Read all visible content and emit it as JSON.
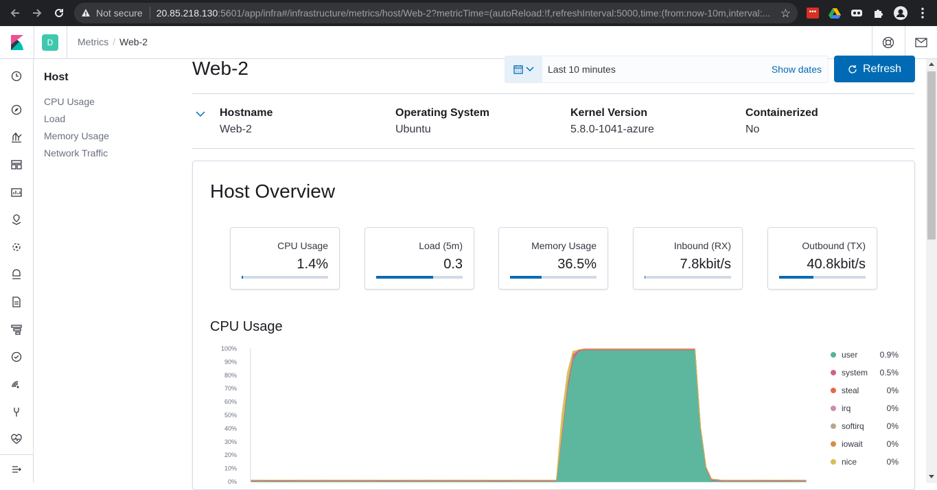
{
  "browser": {
    "security_label": "Not secure",
    "url_host": "20.85.218.130",
    "url_rest": ":5601/app/infra#/infrastructure/metrics/host/Web-2?metricTime=(autoReload:!f,refreshInterval:5000,time:(from:now-10m,interval:..."
  },
  "header": {
    "space_initial": "D",
    "breadcrumbs": [
      "Metrics",
      "Web-2"
    ]
  },
  "sidebar": {
    "title": "Host",
    "items": [
      "CPU Usage",
      "Load",
      "Memory Usage",
      "Network Traffic"
    ]
  },
  "page": {
    "title": "Web-2",
    "time_range": "Last 10 minutes",
    "show_dates": "Show dates",
    "refresh": "Refresh"
  },
  "meta": [
    {
      "label": "Hostname",
      "value": "Web-2"
    },
    {
      "label": "Operating System",
      "value": "Ubuntu"
    },
    {
      "label": "Kernel Version",
      "value": "5.8.0-1041-azure"
    },
    {
      "label": "Containerized",
      "value": "No"
    }
  ],
  "overview": {
    "title": "Host Overview",
    "cards": [
      {
        "label": "CPU Usage",
        "value": "1.4%",
        "fill": 0.014
      },
      {
        "label": "Load (5m)",
        "value": "0.3",
        "fill": 0.66
      },
      {
        "label": "Memory Usage",
        "value": "36.5%",
        "fill": 0.365
      },
      {
        "label": "Inbound (RX)",
        "value": "7.8kbit/s",
        "fill": 0.01
      },
      {
        "label": "Outbound (TX)",
        "value": "40.8kbit/s",
        "fill": 0.4
      }
    ]
  },
  "cpu_section": {
    "title": "CPU Usage"
  },
  "chart_data": {
    "type": "area",
    "title": "CPU Usage",
    "y_ticks": [
      "100%",
      "90%",
      "80%",
      "70%",
      "60%",
      "50%",
      "40%",
      "30%",
      "20%",
      "10%",
      "0%"
    ],
    "ylim": [
      0,
      100
    ],
    "x": [
      0,
      5,
      10,
      15,
      20,
      25,
      30,
      35,
      40,
      45,
      50,
      55,
      56,
      57,
      58,
      59,
      60,
      61,
      62,
      63,
      70,
      75,
      80,
      81,
      82,
      83,
      84,
      85,
      90,
      95,
      100
    ],
    "series": [
      {
        "name": "user",
        "color": "#54b399",
        "legend_value": "0.9%",
        "values": [
          0.5,
          0.5,
          0.5,
          0.5,
          0.5,
          0.5,
          0.5,
          0.5,
          0.5,
          0.5,
          0.5,
          0.5,
          35,
          70,
          92,
          98,
          99,
          99,
          99,
          99,
          99,
          99,
          99,
          40,
          10,
          1,
          1,
          0.5,
          0.5,
          0.5,
          0.5
        ]
      },
      {
        "name": "system",
        "color": "#d36086",
        "legend_value": "0.5%",
        "values": [
          0.6,
          0.8,
          0.6,
          0.7,
          0.6,
          0.8,
          0.6,
          0.7,
          0.6,
          0.8,
          0.6,
          0.6,
          3,
          4,
          4,
          1,
          0.8,
          0.8,
          0.8,
          0.8,
          0.8,
          0.8,
          0.8,
          1,
          1,
          1,
          0.6,
          0.6,
          0.6,
          0.8,
          0.6
        ]
      },
      {
        "name": "steal",
        "color": "#e7664c",
        "legend_value": "0%",
        "values": [
          0,
          0,
          0,
          0,
          0,
          0,
          0,
          0,
          0,
          0,
          0,
          0,
          0,
          0,
          0,
          0,
          0,
          0,
          0,
          0,
          0,
          0,
          0,
          0,
          0,
          0,
          0,
          0,
          0,
          0,
          0
        ]
      },
      {
        "name": "irq",
        "color": "#ca8eae",
        "legend_value": "0%",
        "values": [
          0,
          0,
          0,
          0,
          0,
          0,
          0,
          0,
          0,
          0,
          0,
          0,
          0,
          0,
          0,
          0,
          0,
          0,
          0,
          0,
          0,
          0,
          0,
          0,
          0,
          0,
          0,
          0,
          0,
          0,
          0
        ]
      },
      {
        "name": "softirq",
        "color": "#b9a888",
        "legend_value": "0%",
        "values": [
          0,
          0,
          0,
          0,
          0,
          0,
          0,
          0,
          0,
          0,
          0,
          0,
          0,
          0,
          0,
          0,
          0,
          0,
          0,
          0,
          0,
          0,
          0,
          0,
          0,
          0,
          0,
          0,
          0,
          0,
          0
        ]
      },
      {
        "name": "iowait",
        "color": "#da8b45",
        "legend_value": "0%",
        "values": [
          0,
          0,
          0,
          0,
          0,
          0,
          0,
          0,
          0,
          0,
          0,
          0,
          0,
          0,
          0,
          0,
          0,
          0,
          0,
          0,
          0,
          0,
          0,
          0,
          0,
          0,
          0,
          0,
          0,
          0,
          0
        ]
      },
      {
        "name": "nice",
        "color": "#d6bf57",
        "legend_value": "0%",
        "values": [
          0,
          0,
          0,
          0,
          0,
          0,
          0,
          0,
          0,
          0,
          0,
          0,
          12,
          8,
          2,
          0,
          0,
          0,
          0,
          0,
          0,
          0,
          0,
          0,
          0,
          0,
          0,
          0,
          0,
          0,
          0
        ]
      }
    ]
  }
}
